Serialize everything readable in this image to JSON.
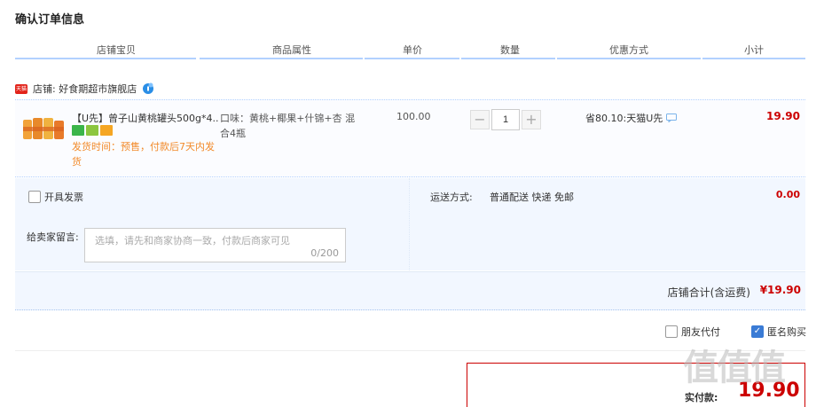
{
  "page_title": "确认订单信息",
  "columns": [
    "店铺宝贝",
    "商品属性",
    "单价",
    "数量",
    "优惠方式",
    "小计"
  ],
  "shop": {
    "label": "店铺: 好食期超市旗舰店",
    "badge": "天猫"
  },
  "item": {
    "title": "【U先】曾子山黄桃罐头500g*4...",
    "attributes": "口味：黄桃+椰果+什锦+杏 混合4瓶",
    "ship_note": "发货时间：预售，付款后7天内发货",
    "price": "100.00",
    "quantity": "1",
    "promo": "省80.10:天猫U先",
    "subtotal": "19.90"
  },
  "extras": {
    "invoice_label": "开具发票",
    "memo_label": "给卖家留言:",
    "memo_placeholder": "选填，请先和商家协商一致，付款后商家可见",
    "memo_count": "0/200",
    "ship_label": "运送方式:",
    "ship_value": "普通配送 快递 免邮",
    "ship_fee": "0.00"
  },
  "shop_total": {
    "label": "店铺合计(含运费)",
    "amount": "¥19.90"
  },
  "options": {
    "friend_pay": "朋友代付",
    "anonymous": "匿名购买",
    "anonymous_checked": true
  },
  "payment": {
    "label": "实付款:",
    "amount": "19.90"
  },
  "watermark": "值值值"
}
